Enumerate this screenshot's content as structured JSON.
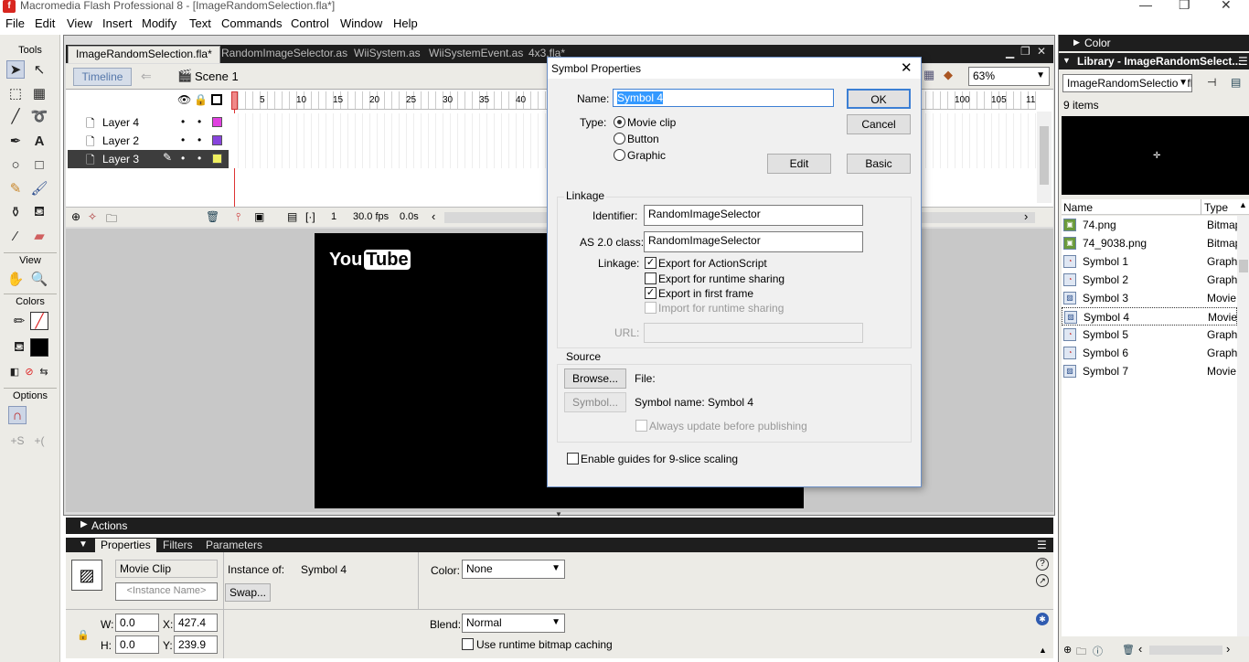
{
  "window": {
    "title": "Macromedia Flash Professional 8 - [ImageRandomSelection.fla*]",
    "minimize": "—",
    "maximize": "❐",
    "close": "✕"
  },
  "menu": [
    "File",
    "Edit",
    "View",
    "Insert",
    "Modify",
    "Text",
    "Commands",
    "Control",
    "Window",
    "Help"
  ],
  "tools": {
    "title": "Tools",
    "view_label": "View",
    "colors_label": "Colors",
    "options_label": "Options"
  },
  "doc_tabs": [
    "ImageRandomSelection.fla*",
    "RandomImageSelector.as",
    "WiiSystem.as",
    "WiiSystemEvent.as",
    "4x3.fla*"
  ],
  "editbar": {
    "timeline_button": "Timeline",
    "scene_label": "Scene 1",
    "zoom": "63%"
  },
  "timeline": {
    "layers": [
      "Layer 4",
      "Layer 2",
      "Layer 3"
    ],
    "frame_numbers": [
      "5",
      "10",
      "15",
      "20",
      "25",
      "30",
      "35",
      "40",
      "100",
      "105",
      "11"
    ],
    "current_frame": "1",
    "fps": "30.0 fps",
    "time": "0.0s"
  },
  "stage": {
    "logo_you": "You",
    "logo_tube": "Tube"
  },
  "actions_panel": {
    "title": "Actions"
  },
  "properties": {
    "tabs": [
      "Properties",
      "Filters",
      "Parameters"
    ],
    "symbol_type": "Movie Clip",
    "instance_placeholder": "<Instance Name>",
    "instance_of_label": "Instance of:",
    "instance_of_value": "Symbol 4",
    "swap_button": "Swap...",
    "color_label": "Color:",
    "color_value": "None",
    "w_label": "W:",
    "w_value": "0.0",
    "h_label": "H:",
    "h_value": "0.0",
    "x_label": "X:",
    "x_value": "427.4",
    "y_label": "Y:",
    "y_value": "239.9",
    "blend_label": "Blend:",
    "blend_value": "Normal",
    "bitmap_caching_label": "Use runtime bitmap caching"
  },
  "color_panel": {
    "title": "Color"
  },
  "library": {
    "title": "Library - ImageRandomSelect...",
    "file_select": "ImageRandomSelection.fla",
    "count": "9 items",
    "col_name": "Name",
    "col_type": "Type",
    "items": [
      {
        "name": "74.png",
        "type": "Bitmap"
      },
      {
        "name": "74_9038.png",
        "type": "Bitmap"
      },
      {
        "name": "Symbol 1",
        "type": "Graphic"
      },
      {
        "name": "Symbol 2",
        "type": "Graphic"
      },
      {
        "name": "Symbol 3",
        "type": "Movie Clip"
      },
      {
        "name": "Symbol 4",
        "type": "Movie Clip"
      },
      {
        "name": "Symbol 5",
        "type": "Graphic"
      },
      {
        "name": "Symbol 6",
        "type": "Graphic"
      },
      {
        "name": "Symbol 7",
        "type": "Movie Clip"
      }
    ]
  },
  "dialog": {
    "title": "Symbol Properties",
    "name_label": "Name:",
    "name_value": "Symbol 4",
    "type_label": "Type:",
    "type_options": [
      "Movie clip",
      "Button",
      "Graphic"
    ],
    "ok": "OK",
    "cancel": "Cancel",
    "edit": "Edit",
    "basic": "Basic",
    "linkage_group": "Linkage",
    "identifier_label": "Identifier:",
    "identifier_value": "RandomImageSelector",
    "as2_label": "AS 2.0 class:",
    "as2_value": "RandomImageSelector",
    "linkage_label": "Linkage:",
    "linkage_options": [
      {
        "label": "Export for ActionScript",
        "checked": true,
        "enabled": true
      },
      {
        "label": "Export for runtime sharing",
        "checked": false,
        "enabled": true
      },
      {
        "label": "Export in first frame",
        "checked": true,
        "enabled": true
      },
      {
        "label": "Import for runtime sharing",
        "checked": false,
        "enabled": false
      }
    ],
    "url_label": "URL:",
    "source_group": "Source",
    "browse": "Browse...",
    "file_label": "File:",
    "symbol_button": "Symbol...",
    "symbol_name": "Symbol name: Symbol 4",
    "always_update": "Always update before publishing",
    "nine_slice": "Enable guides for 9-slice scaling"
  }
}
